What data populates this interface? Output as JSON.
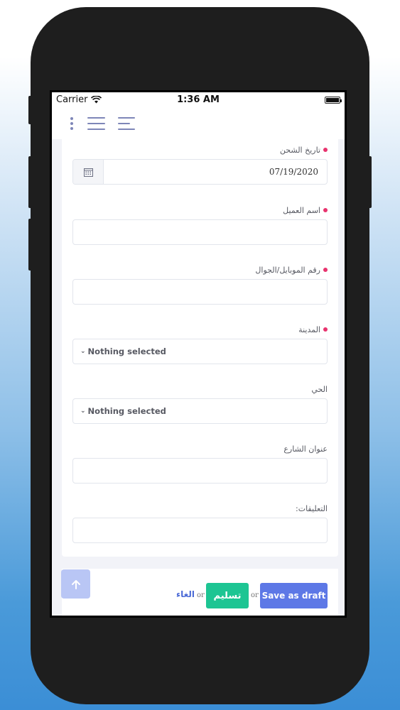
{
  "statusbar": {
    "carrier": "Carrier",
    "time": "1:36 AM"
  },
  "form": {
    "shipping_date": {
      "label": "تاريخ الشحن",
      "value": "07/19/2020",
      "required": true
    },
    "customer_name": {
      "label": "اسم العميل",
      "value": "",
      "required": true
    },
    "mobile": {
      "label": "رقم الموبايل/الجوال",
      "value": "",
      "required": true
    },
    "city": {
      "label": "المدينة",
      "selected": "Nothing selected",
      "required": true
    },
    "district": {
      "label": "الحي",
      "selected": "Nothing selected",
      "required": false
    },
    "street": {
      "label": "عنوان الشارع",
      "value": "",
      "required": false
    },
    "comments": {
      "label": "التعليقات:",
      "value": "",
      "required": false
    }
  },
  "actions": {
    "save_draft": "Save as draft",
    "or1": "or",
    "submit": "تسليم",
    "or2": "or",
    "cancel": "الغاء"
  },
  "colors": {
    "required_dot": "#e8336e",
    "primary": "#5d78e6",
    "success": "#1dc593",
    "link": "#4c6bd6"
  }
}
